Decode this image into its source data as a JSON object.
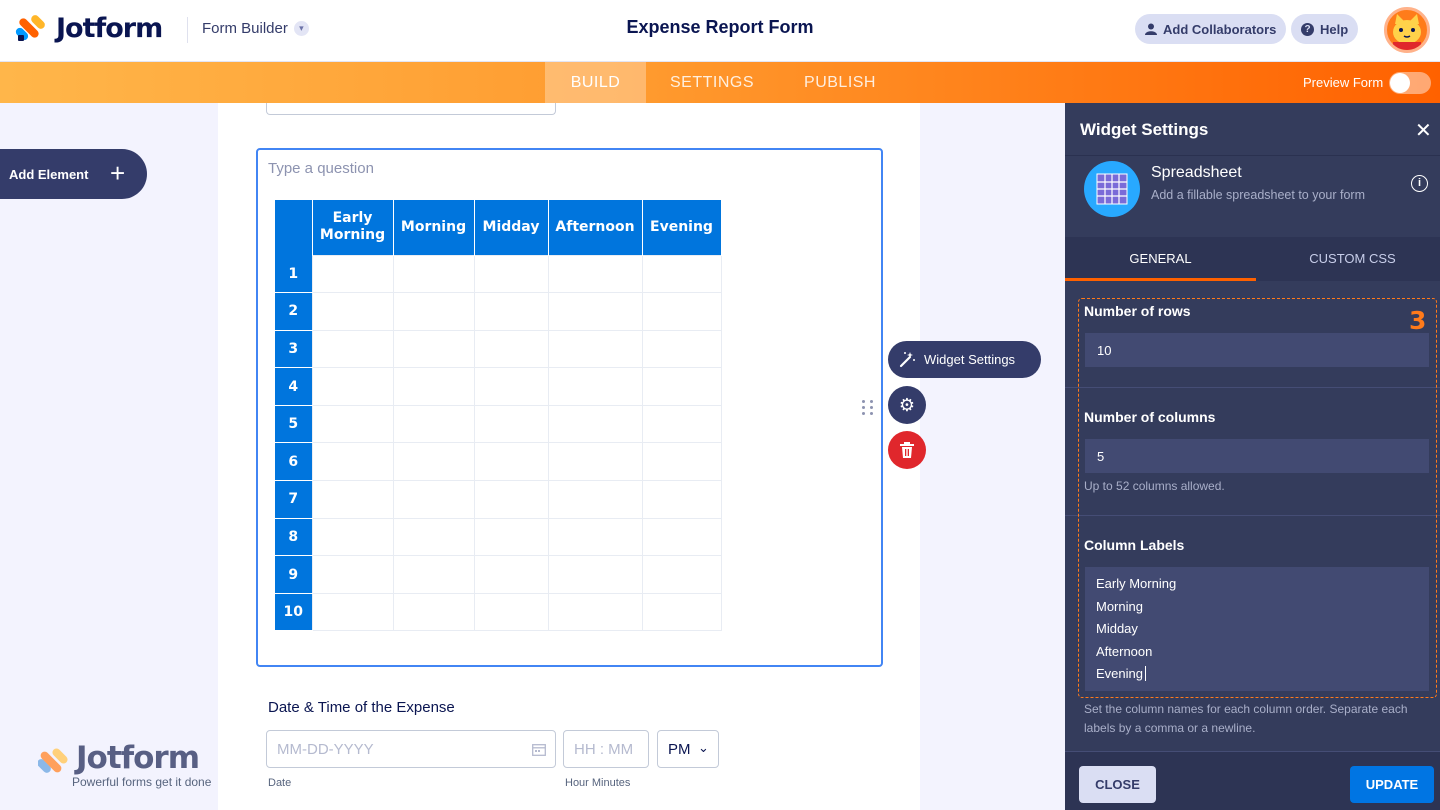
{
  "header": {
    "logo_text": "Jotform",
    "form_builder_label": "Form Builder",
    "form_title": "Expense Report Form",
    "add_collaborators_label": "Add Collaborators",
    "help_label": "Help"
  },
  "nav": {
    "tabs": [
      {
        "label": "BUILD",
        "active": true
      },
      {
        "label": "SETTINGS",
        "active": false
      },
      {
        "label": "PUBLISH",
        "active": false
      }
    ],
    "preview_label": "Preview Form"
  },
  "canvas": {
    "add_element_label": "Add Element",
    "question_placeholder": "Type a question",
    "spreadsheet": {
      "columns": [
        "Early Morning",
        "Morning",
        "Midday",
        "Afternoon",
        "Evening"
      ],
      "rows": [
        "1",
        "2",
        "3",
        "4",
        "5",
        "6",
        "7",
        "8",
        "9",
        "10"
      ]
    },
    "widget_settings_label": "Widget Settings",
    "date_section": {
      "title": "Date & Time of the Expense",
      "date_placeholder": "MM-DD-YYYY",
      "time_placeholder": "HH : MM",
      "ampm_value": "PM",
      "date_sublabel": "Date",
      "time_sublabel": "Hour Minutes"
    },
    "footer_logo": {
      "name": "Jotform",
      "tagline": "Powerful forms get it done"
    }
  },
  "panel": {
    "title": "Widget Settings",
    "widget_name": "Spreadsheet",
    "widget_description": "Add a fillable spreadsheet to your form",
    "tabs": [
      {
        "label": "GENERAL",
        "active": true
      },
      {
        "label": "CUSTOM CSS",
        "active": false
      }
    ],
    "step_number": "3",
    "rows_label": "Number of rows",
    "rows_value": "10",
    "columns_label": "Number of columns",
    "columns_value": "5",
    "columns_hint": "Up to 52 columns allowed.",
    "column_labels_label": "Column Labels",
    "column_labels_lines": [
      "Early Morning",
      "Morning",
      "Midday",
      "Afternoon",
      "Evening"
    ],
    "column_labels_hint": "Set the column names for each column order. Separate each labels by a comma or a newline.",
    "close_label": "CLOSE",
    "update_label": "UPDATE"
  },
  "colors": {
    "brand_navy": "#0a1551",
    "accent_orange": "#ff6100",
    "table_blue": "#0075dd",
    "panel_bg": "#343c5c",
    "delete_red": "#e0272c"
  }
}
